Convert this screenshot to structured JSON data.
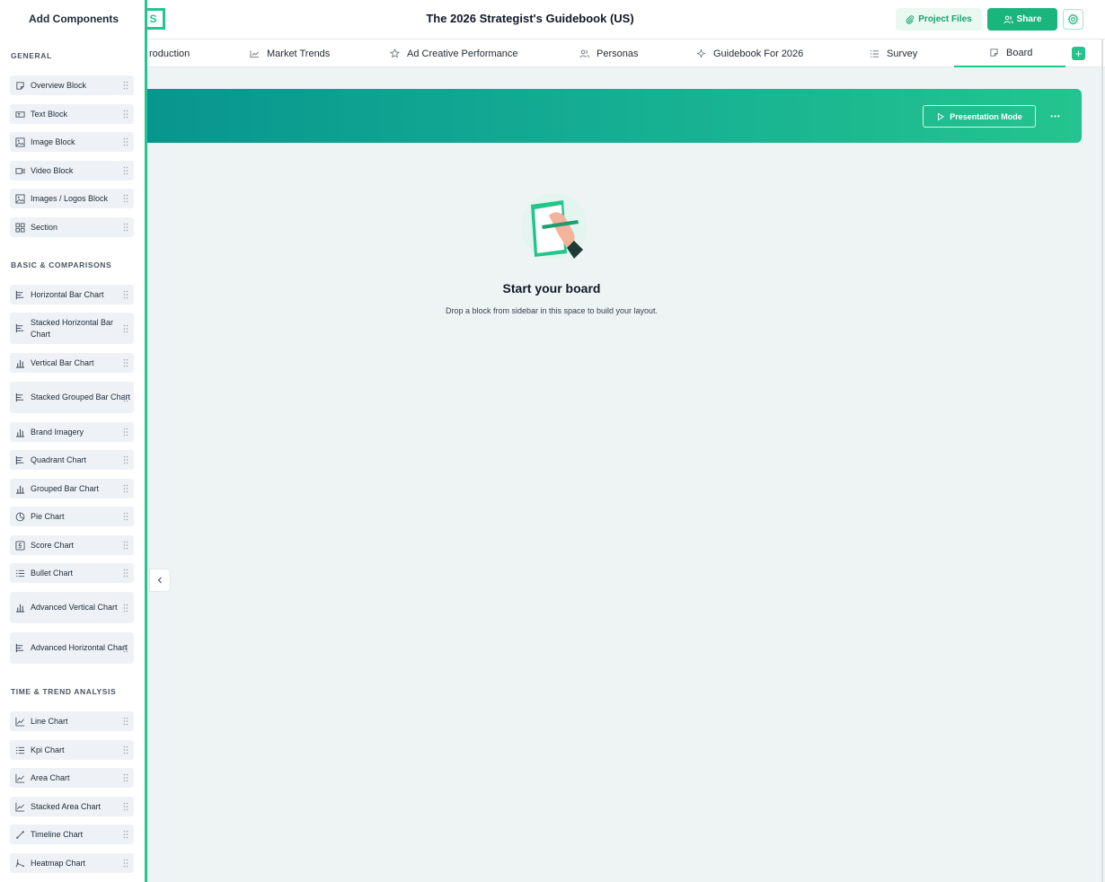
{
  "sidebar": {
    "title": "Add Components",
    "sections": {
      "general": "GENERAL",
      "basic": "BASIC & COMPARISONS",
      "time": "TIME & TREND ANALYSIS"
    },
    "general_items": [
      "Overview Block",
      "Text Block",
      "Image Block",
      "Video Block",
      "Images / Logos Block",
      "Section"
    ],
    "basic_items": [
      "Horizontal Bar Chart",
      "Stacked Horizontal Bar Chart",
      "Vertical Bar Chart",
      "Stacked Grouped Bar Chart",
      "Brand Imagery",
      "Quadrant Chart",
      "Grouped Bar Chart",
      "Pie Chart",
      "Score Chart",
      "Bullet Chart",
      "Advanced Vertical Chart",
      "Advanced Horizontal Chart"
    ],
    "time_items": [
      "Line Chart",
      "Kpi Chart",
      "Area Chart",
      "Stacked Area Chart",
      "Timeline Chart",
      "Heatmap Chart"
    ]
  },
  "header": {
    "logo_fragment": "S",
    "title": "The 2026 Strategist's Guidebook (US)",
    "project_files": "Project Files",
    "share": "Share"
  },
  "tabs": [
    "roduction",
    "Market Trends",
    "Ad Creative Performance",
    "Personas",
    "Guidebook For 2026",
    "Survey",
    "Board"
  ],
  "tabs_add": "+",
  "banner": {
    "presentation_mode": "Presentation Mode",
    "more": "•••"
  },
  "empty": {
    "title": "Start your board",
    "subtitle": "Drop a block from sidebar in this space to build your layout."
  },
  "colors": {
    "accent": "#22c58b",
    "banner_start": "#08958f",
    "banner_end": "#24c48e"
  }
}
